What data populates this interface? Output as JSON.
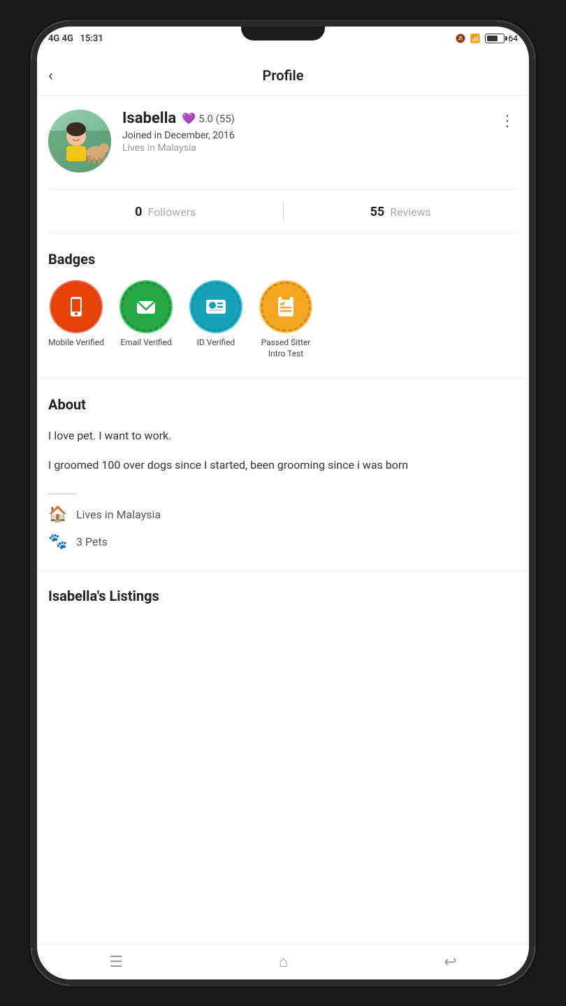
{
  "statusBar": {
    "network": "4G 4G",
    "time": "15:31",
    "battery": 64
  },
  "header": {
    "title": "Profile",
    "backLabel": "‹"
  },
  "profile": {
    "name": "Isabella",
    "rating": "5.0",
    "reviewCount": "55",
    "joinDate": "Joined in December, 2016",
    "location": "Lives in Malaysia",
    "followersCount": "0",
    "followersLabel": "Followers",
    "reviewsCount": "55",
    "reviewsLabel": "Reviews"
  },
  "badges": {
    "title": "Badges",
    "items": [
      {
        "label": "Mobile Verified",
        "type": "orange"
      },
      {
        "label": "Email Verified",
        "type": "green"
      },
      {
        "label": "ID Verified",
        "type": "teal"
      },
      {
        "label": "Passed Sitter Intro Test",
        "type": "yellow"
      }
    ]
  },
  "about": {
    "title": "About",
    "text1": "I love pet. I want to work.",
    "text2": "I groomed 100 over dogs since I started, been grooming since i was born"
  },
  "details": {
    "location": "Lives in Malaysia",
    "pets": "3 Pets"
  },
  "listings": {
    "title": "Isabella's Listings"
  },
  "nav": {
    "menuLabel": "☰",
    "homeLabel": "⌂",
    "backLabel": "↩"
  }
}
